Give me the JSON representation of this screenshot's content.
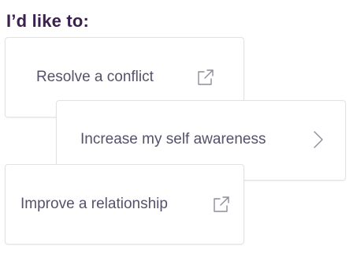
{
  "heading": "I’d like to:",
  "options": [
    {
      "label": "Resolve a conflict",
      "icon": "external-link-icon"
    },
    {
      "label": "Increase my self awareness",
      "icon": "chevron-right-icon"
    },
    {
      "label": "Improve a relationship",
      "icon": "external-link-icon"
    }
  ],
  "colors": {
    "heading": "#3a1f4f",
    "label": "#54526a",
    "icon": "#8e8c99",
    "border": "#e2e1e6"
  }
}
